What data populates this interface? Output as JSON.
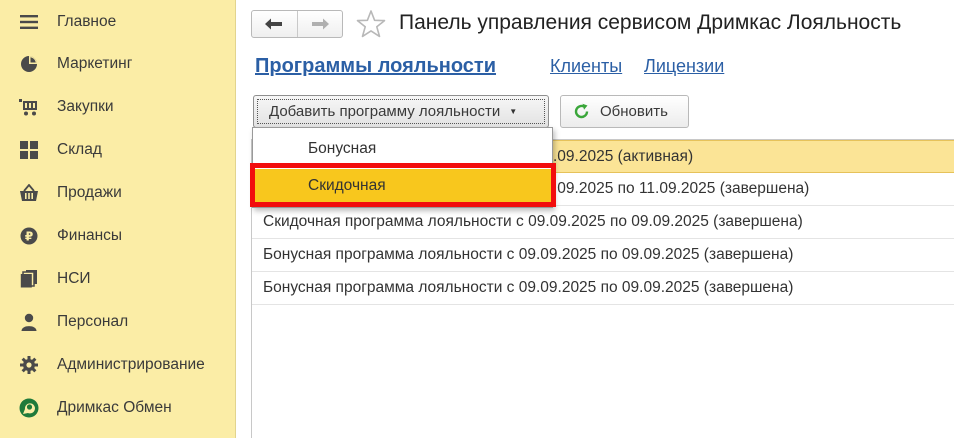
{
  "sidebar": {
    "items": [
      {
        "label": "Главное",
        "icon": "menu-icon"
      },
      {
        "label": "Маркетинг",
        "icon": "pie-chart-icon"
      },
      {
        "label": "Закупки",
        "icon": "cart-icon"
      },
      {
        "label": "Склад",
        "icon": "grid-icon"
      },
      {
        "label": "Продажи",
        "icon": "basket-icon"
      },
      {
        "label": "Финансы",
        "icon": "ruble-icon"
      },
      {
        "label": "НСИ",
        "icon": "documents-icon"
      },
      {
        "label": "Персонал",
        "icon": "person-icon"
      },
      {
        "label": "Администрирование",
        "icon": "gear-icon"
      },
      {
        "label": "Дримкас Обмен",
        "icon": "exchange-icon"
      }
    ]
  },
  "header": {
    "title": "Панель управления сервисом Дримкас Лояльность"
  },
  "tabs": [
    {
      "label": "Программы лояльности"
    },
    {
      "label": "Клиенты"
    },
    {
      "label": "Лицензии"
    }
  ],
  "toolbar": {
    "add_label": "Добавить программу лояльности",
    "refresh_label": "Обновить"
  },
  "dropdown": {
    "items": [
      {
        "label": "Бонусная"
      },
      {
        "label": "Скидочная"
      }
    ]
  },
  "list": {
    "rows": [
      {
        "text": ".09.2025 (активная)"
      },
      {
        "text": ".09.2025 по 11.09.2025 (завершена)"
      },
      {
        "text": "Скидочная программа лояльности с 09.09.2025 по 09.09.2025 (завершена)"
      },
      {
        "text": "Бонусная программа лояльности с 09.09.2025 по 09.09.2025 (завершена)"
      },
      {
        "text": "Бонусная программа лояльности с 09.09.2025 по 09.09.2025 (завершена)"
      }
    ]
  },
  "colors": {
    "sidebar_bg": "#fbeda6",
    "link": "#2b5fa5",
    "selected_row": "#fbe496",
    "dropdown_highlight": "#f8c71d",
    "annotation_red": "#f20d0d",
    "refresh_icon": "#3aa63a"
  }
}
